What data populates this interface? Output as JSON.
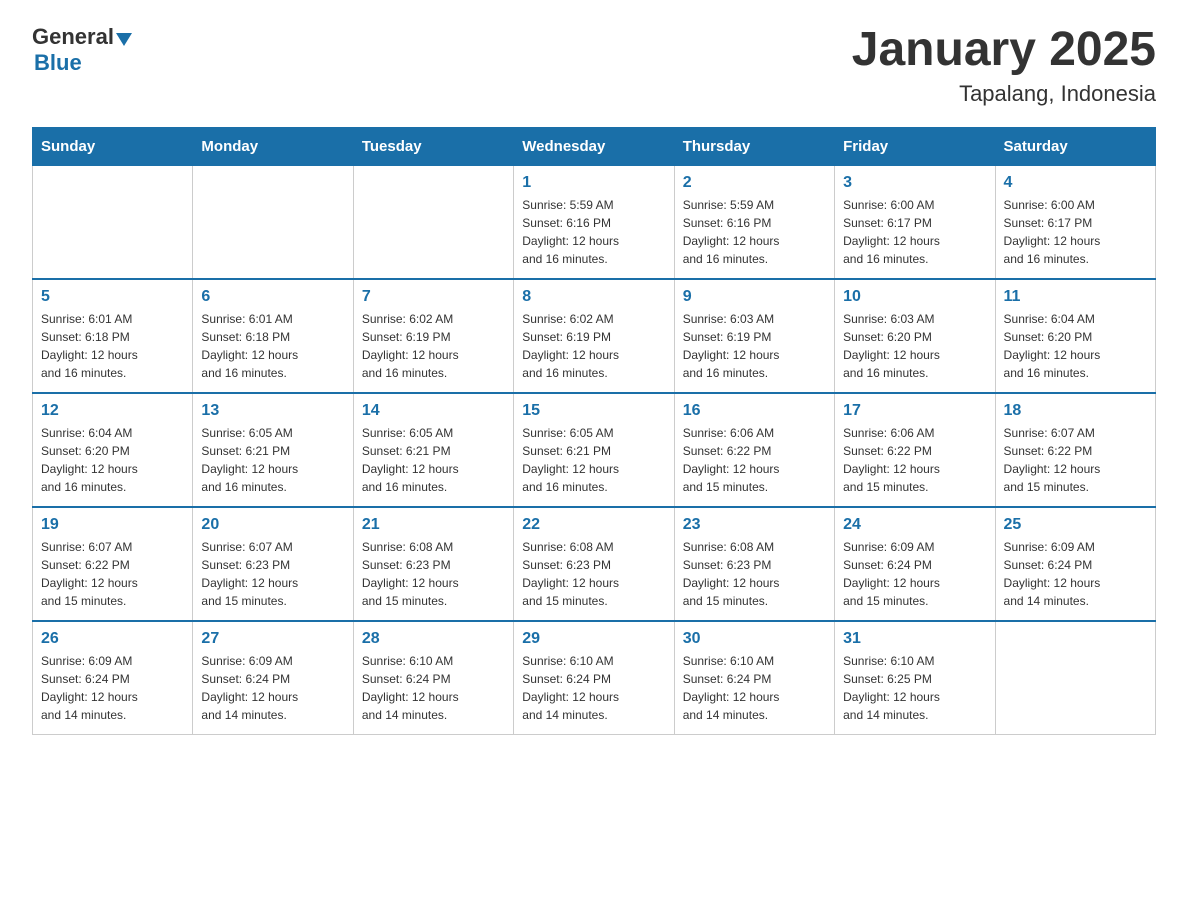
{
  "header": {
    "logo_general": "General",
    "logo_blue": "Blue",
    "title": "January 2025",
    "subtitle": "Tapalang, Indonesia"
  },
  "days_of_week": [
    "Sunday",
    "Monday",
    "Tuesday",
    "Wednesday",
    "Thursday",
    "Friday",
    "Saturday"
  ],
  "weeks": [
    [
      {
        "day": "",
        "info": ""
      },
      {
        "day": "",
        "info": ""
      },
      {
        "day": "",
        "info": ""
      },
      {
        "day": "1",
        "info": "Sunrise: 5:59 AM\nSunset: 6:16 PM\nDaylight: 12 hours\nand 16 minutes."
      },
      {
        "day": "2",
        "info": "Sunrise: 5:59 AM\nSunset: 6:16 PM\nDaylight: 12 hours\nand 16 minutes."
      },
      {
        "day": "3",
        "info": "Sunrise: 6:00 AM\nSunset: 6:17 PM\nDaylight: 12 hours\nand 16 minutes."
      },
      {
        "day": "4",
        "info": "Sunrise: 6:00 AM\nSunset: 6:17 PM\nDaylight: 12 hours\nand 16 minutes."
      }
    ],
    [
      {
        "day": "5",
        "info": "Sunrise: 6:01 AM\nSunset: 6:18 PM\nDaylight: 12 hours\nand 16 minutes."
      },
      {
        "day": "6",
        "info": "Sunrise: 6:01 AM\nSunset: 6:18 PM\nDaylight: 12 hours\nand 16 minutes."
      },
      {
        "day": "7",
        "info": "Sunrise: 6:02 AM\nSunset: 6:19 PM\nDaylight: 12 hours\nand 16 minutes."
      },
      {
        "day": "8",
        "info": "Sunrise: 6:02 AM\nSunset: 6:19 PM\nDaylight: 12 hours\nand 16 minutes."
      },
      {
        "day": "9",
        "info": "Sunrise: 6:03 AM\nSunset: 6:19 PM\nDaylight: 12 hours\nand 16 minutes."
      },
      {
        "day": "10",
        "info": "Sunrise: 6:03 AM\nSunset: 6:20 PM\nDaylight: 12 hours\nand 16 minutes."
      },
      {
        "day": "11",
        "info": "Sunrise: 6:04 AM\nSunset: 6:20 PM\nDaylight: 12 hours\nand 16 minutes."
      }
    ],
    [
      {
        "day": "12",
        "info": "Sunrise: 6:04 AM\nSunset: 6:20 PM\nDaylight: 12 hours\nand 16 minutes."
      },
      {
        "day": "13",
        "info": "Sunrise: 6:05 AM\nSunset: 6:21 PM\nDaylight: 12 hours\nand 16 minutes."
      },
      {
        "day": "14",
        "info": "Sunrise: 6:05 AM\nSunset: 6:21 PM\nDaylight: 12 hours\nand 16 minutes."
      },
      {
        "day": "15",
        "info": "Sunrise: 6:05 AM\nSunset: 6:21 PM\nDaylight: 12 hours\nand 16 minutes."
      },
      {
        "day": "16",
        "info": "Sunrise: 6:06 AM\nSunset: 6:22 PM\nDaylight: 12 hours\nand 15 minutes."
      },
      {
        "day": "17",
        "info": "Sunrise: 6:06 AM\nSunset: 6:22 PM\nDaylight: 12 hours\nand 15 minutes."
      },
      {
        "day": "18",
        "info": "Sunrise: 6:07 AM\nSunset: 6:22 PM\nDaylight: 12 hours\nand 15 minutes."
      }
    ],
    [
      {
        "day": "19",
        "info": "Sunrise: 6:07 AM\nSunset: 6:22 PM\nDaylight: 12 hours\nand 15 minutes."
      },
      {
        "day": "20",
        "info": "Sunrise: 6:07 AM\nSunset: 6:23 PM\nDaylight: 12 hours\nand 15 minutes."
      },
      {
        "day": "21",
        "info": "Sunrise: 6:08 AM\nSunset: 6:23 PM\nDaylight: 12 hours\nand 15 minutes."
      },
      {
        "day": "22",
        "info": "Sunrise: 6:08 AM\nSunset: 6:23 PM\nDaylight: 12 hours\nand 15 minutes."
      },
      {
        "day": "23",
        "info": "Sunrise: 6:08 AM\nSunset: 6:23 PM\nDaylight: 12 hours\nand 15 minutes."
      },
      {
        "day": "24",
        "info": "Sunrise: 6:09 AM\nSunset: 6:24 PM\nDaylight: 12 hours\nand 15 minutes."
      },
      {
        "day": "25",
        "info": "Sunrise: 6:09 AM\nSunset: 6:24 PM\nDaylight: 12 hours\nand 14 minutes."
      }
    ],
    [
      {
        "day": "26",
        "info": "Sunrise: 6:09 AM\nSunset: 6:24 PM\nDaylight: 12 hours\nand 14 minutes."
      },
      {
        "day": "27",
        "info": "Sunrise: 6:09 AM\nSunset: 6:24 PM\nDaylight: 12 hours\nand 14 minutes."
      },
      {
        "day": "28",
        "info": "Sunrise: 6:10 AM\nSunset: 6:24 PM\nDaylight: 12 hours\nand 14 minutes."
      },
      {
        "day": "29",
        "info": "Sunrise: 6:10 AM\nSunset: 6:24 PM\nDaylight: 12 hours\nand 14 minutes."
      },
      {
        "day": "30",
        "info": "Sunrise: 6:10 AM\nSunset: 6:24 PM\nDaylight: 12 hours\nand 14 minutes."
      },
      {
        "day": "31",
        "info": "Sunrise: 6:10 AM\nSunset: 6:25 PM\nDaylight: 12 hours\nand 14 minutes."
      },
      {
        "day": "",
        "info": ""
      }
    ]
  ]
}
